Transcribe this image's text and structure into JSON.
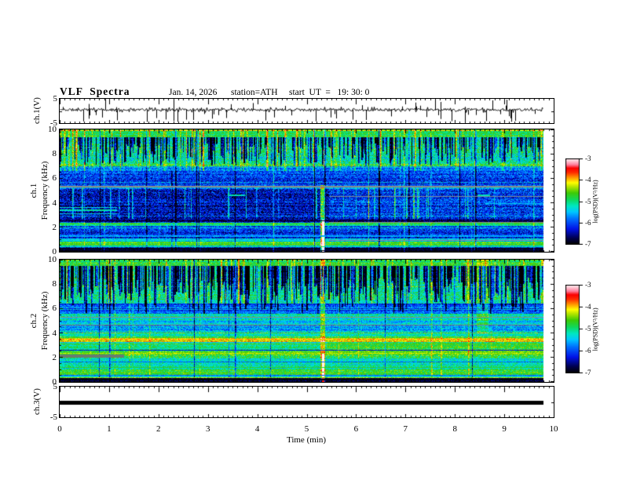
{
  "header": {
    "title": "VLF  Spectra",
    "date": "Jan. 14, 2026",
    "station": "station=ATH",
    "start_ut": "start  UT  =   19: 30: 0"
  },
  "x_axis": {
    "label": "Time  (min)",
    "major_ticks": [
      "0",
      "1",
      "2",
      "3",
      "4",
      "5",
      "6",
      "7",
      "8",
      "9",
      "10"
    ],
    "minor_step_min": 0.1,
    "range_min": [
      0,
      10
    ]
  },
  "panels": {
    "ch1_wave": {
      "ylabel": "ch.1(V)",
      "yticks": [
        "5",
        "-5"
      ],
      "ylim": [
        -5,
        5
      ]
    },
    "ch1_spec": {
      "ylabel_channel": "ch.1",
      "ylabel_axis": "Frequency  (kHz)",
      "yticks": [
        "10",
        "8",
        "6",
        "4",
        "2",
        "0"
      ],
      "ylim": [
        0,
        10
      ]
    },
    "ch2_spec": {
      "ylabel_channel": "ch.2",
      "ylabel_axis": "Frequency  (kHz)",
      "yticks": [
        "10",
        "8",
        "6",
        "4",
        "2",
        "0"
      ],
      "ylim": [
        0,
        10
      ]
    },
    "ch3_wave": {
      "ylabel": "ch.3(V)",
      "yticks": [
        "5",
        "-5"
      ],
      "ylim": [
        -5,
        5
      ]
    }
  },
  "colorbar": {
    "label": "log(PSD)(V²/Hz)",
    "ticks": [
      "-3",
      "-4",
      "-5",
      "-6",
      "-7"
    ],
    "range": [
      -7,
      -3
    ],
    "gradient_stops": [
      [
        0.0,
        "#000000"
      ],
      [
        0.07,
        "#00004a"
      ],
      [
        0.18,
        "#0013e8"
      ],
      [
        0.3,
        "#0073ff"
      ],
      [
        0.38,
        "#00c8ff"
      ],
      [
        0.45,
        "#00e8c0"
      ],
      [
        0.52,
        "#0fd95f"
      ],
      [
        0.6,
        "#3ecb06"
      ],
      [
        0.68,
        "#c0e800"
      ],
      [
        0.72,
        "#ffff00"
      ],
      [
        0.78,
        "#ff9700"
      ],
      [
        0.84,
        "#ff2a00"
      ],
      [
        0.89,
        "#fb0000"
      ],
      [
        0.93,
        "#ff7c9a"
      ],
      [
        0.97,
        "#ffc3d0"
      ],
      [
        1.0,
        "#fff2f5"
      ]
    ]
  },
  "chart_data": [
    {
      "type": "line",
      "panel": "ch1_wave",
      "title": "ch.1 voltage waveform",
      "ylim": [
        -5,
        5
      ],
      "x_data_end_min": 9.8,
      "signal": {
        "baseline_v": 0.5,
        "noise_amp_v": 0.55,
        "spike_count": 62,
        "spike_amp_v": [
          1.2,
          4.6
        ],
        "spike_downward_fraction": 0.7
      },
      "seed": 11
    },
    {
      "type": "heatmap",
      "panel": "ch1_spec",
      "xlim": [
        0,
        10
      ],
      "ylim": [
        0,
        10
      ],
      "x_data_end_min": 9.8,
      "value_range": [
        -7,
        -3
      ],
      "bands": [
        {
          "f0": 0.0,
          "f1": 0.3,
          "level": -6.9,
          "var": 0.15
        },
        {
          "f0": 0.3,
          "f1": 0.5,
          "level": -6.2,
          "var": 0.45
        },
        {
          "f0": 0.5,
          "f1": 0.82,
          "level": -4.65,
          "var": 0.3
        },
        {
          "f0": 0.82,
          "f1": 1.05,
          "level": -5.4,
          "var": 0.35
        },
        {
          "f0": 1.05,
          "f1": 2.1,
          "level": -6.15,
          "var": 0.5
        },
        {
          "f0": 2.1,
          "f1": 2.35,
          "level": -4.95,
          "var": 0.35
        },
        {
          "f0": 2.35,
          "f1": 2.65,
          "level": -6.6,
          "var": 0.45
        },
        {
          "f0": 2.65,
          "f1": 5.2,
          "level": -6.4,
          "var": 0.55
        },
        {
          "f0": 5.2,
          "f1": 5.45,
          "level": -5.7,
          "var": 0.5
        },
        {
          "f0": 5.45,
          "f1": 6.6,
          "level": -6.1,
          "var": 0.5
        },
        {
          "f0": 6.6,
          "f1": 7.0,
          "level": -5.7,
          "var": 0.5
        },
        {
          "f0": 7.0,
          "f1": 9.4,
          "level": -5.15,
          "var": 0.5
        },
        {
          "f0": 9.4,
          "f1": 10.0,
          "level": -4.8,
          "var": 0.35
        }
      ],
      "lines": [
        {
          "f": 0.08,
          "w": 0.07,
          "level": -7
        },
        {
          "f": 0.22,
          "w": 0.05,
          "level": -7
        },
        {
          "f": 0.4,
          "w": 0.05,
          "level": -5.1
        },
        {
          "f": 1.27,
          "w": 0.1,
          "level": -5.6
        },
        {
          "f": 2.5,
          "w": 0.06,
          "level": -6.9
        },
        {
          "f": 3.08,
          "w": 0.06,
          "level": -5.4,
          "t1": 1.15
        },
        {
          "f": 3.38,
          "w": 0.08,
          "level": -5.2,
          "t1": 1.15
        },
        {
          "f": 3.62,
          "w": 0.07,
          "level": -5.3,
          "t1": 1.15
        },
        {
          "f": 4.6,
          "w": 0.16,
          "level": -5.2,
          "t0": 3.4,
          "t1": 3.75
        },
        {
          "f": 4.62,
          "w": 0.14,
          "level": -5.15,
          "t0": 8.45,
          "t1": 8.7
        },
        {
          "f": 3.95,
          "w": 0.07,
          "level": -5.5,
          "t0": 8.6
        },
        {
          "f": 5.32,
          "w": 0.09,
          "color": "#8a8a8a"
        },
        {
          "f": 4.52,
          "w": 0.12,
          "color": "#7d8e96",
          "t0": 5.45
        },
        {
          "f": 2.38,
          "w": 0.06,
          "color": "#8a8a80",
          "t0": 5.45
        },
        {
          "f": 0.88,
          "w": 0.05,
          "color": "#8a8a8a",
          "t0": 5.45
        }
      ],
      "patches": [
        {
          "f0": 2.65,
          "f1": 5.2,
          "t0": 5.45,
          "dlevel": 0.3
        }
      ],
      "vfeatures": [
        {
          "density": 0.42,
          "f_top": 9.4,
          "f_bottom": [
            7.0,
            8.9
          ],
          "dlevel": -1.7
        },
        {
          "density": 0.07,
          "f_top": 10.0,
          "f_bottom": [
            6.6,
            6.6
          ],
          "dlevel": 0.7
        },
        {
          "density": 0.06,
          "f_top": 5.2,
          "f_bottom": [
            2.65,
            2.65
          ],
          "dlevel": 0.9
        },
        {
          "density": 0.02,
          "f_top": 10.0,
          "f_bottom": [
            0,
            0
          ],
          "dlevel": -1.1
        },
        {
          "density": 0.03,
          "f_top": 10.0,
          "f_bottom": [
            0,
            0
          ],
          "dlevel": 0.45
        }
      ],
      "events": [
        {
          "t": 5.32,
          "w": 0.08,
          "f0": 0,
          "f1": 5.45,
          "dlevel": 1.6
        },
        {
          "t": 5.32,
          "w": 0.035,
          "f0": 0,
          "f1": 2.6,
          "dlevel": 2.6
        }
      ],
      "row_noise": {
        "bright_prob": 0.09,
        "bright_boost": 0.55,
        "base": 0.22
      },
      "seed": 23
    },
    {
      "type": "heatmap",
      "panel": "ch2_spec",
      "xlim": [
        0,
        10
      ],
      "ylim": [
        0,
        10
      ],
      "x_data_end_min": 9.8,
      "value_range": [
        -7,
        -3
      ],
      "bands": [
        {
          "f0": 0.0,
          "f1": 0.3,
          "level": -6.8,
          "var": 0.25
        },
        {
          "f0": 0.3,
          "f1": 0.62,
          "level": -5.3,
          "var": 0.4
        },
        {
          "f0": 0.62,
          "f1": 0.95,
          "level": -4.85,
          "var": 0.35
        },
        {
          "f0": 0.95,
          "f1": 1.9,
          "level": -5.15,
          "var": 0.4
        },
        {
          "f0": 1.9,
          "f1": 2.22,
          "level": -4.95,
          "var": 0.5
        },
        {
          "f0": 2.22,
          "f1": 2.5,
          "level": -4.55,
          "var": 0.3
        },
        {
          "f0": 2.5,
          "f1": 3.28,
          "level": -5.1,
          "var": 0.35
        },
        {
          "f0": 3.28,
          "f1": 3.58,
          "level": -4.35,
          "var": 0.4
        },
        {
          "f0": 3.58,
          "f1": 4.05,
          "level": -5.25,
          "var": 0.35
        },
        {
          "f0": 4.05,
          "f1": 4.62,
          "level": -5.65,
          "var": 0.45
        },
        {
          "f0": 4.62,
          "f1": 5.2,
          "level": -5.45,
          "var": 0.4
        },
        {
          "f0": 5.2,
          "f1": 5.55,
          "level": -5.15,
          "var": 0.4
        },
        {
          "f0": 5.55,
          "f1": 6.45,
          "level": -6.1,
          "var": 0.45
        },
        {
          "f0": 6.45,
          "f1": 9.5,
          "level": -5.05,
          "var": 0.45
        },
        {
          "f0": 9.5,
          "f1": 10.0,
          "level": -4.85,
          "var": 0.35
        }
      ],
      "lines": [
        {
          "f": 3.46,
          "w": 0.1,
          "level": -3.95
        },
        {
          "f": 3.1,
          "w": 0.06,
          "level": -4.6
        },
        {
          "f": 2.6,
          "w": 0.08,
          "level": -6.3
        },
        {
          "f": 2.35,
          "w": 0.06,
          "level": -4.3
        },
        {
          "f": 1.62,
          "w": 0.06,
          "level": -5.9
        },
        {
          "f": 1.18,
          "w": 0.07,
          "level": -4.75
        },
        {
          "f": 0.78,
          "w": 0.05,
          "level": -4.5
        },
        {
          "f": 0.5,
          "w": 0.05,
          "level": -5.9
        },
        {
          "f": 0.35,
          "w": 0.06,
          "level": -4.35
        },
        {
          "f": 0.1,
          "w": 0.06,
          "level": -7
        },
        {
          "f": 0.2,
          "w": 0.05,
          "level": -7
        },
        {
          "f": 5.3,
          "w": 0.08,
          "color": "#8a8a8a"
        },
        {
          "f": 4.62,
          "w": 0.07,
          "color": "#7d7d7d"
        },
        {
          "f": 2.1,
          "w": 0.25,
          "color": "#6a7a72",
          "t1": 1.3
        },
        {
          "f": 4.35,
          "w": 0.05,
          "level": -6.2
        }
      ],
      "patches": [
        {
          "f0": 2.5,
          "f1": 3.28,
          "t0": 5.4,
          "dlevel": 0.3
        },
        {
          "f0": 1.9,
          "f1": 2.5,
          "t0": 1.3,
          "dlevel": 0.15
        }
      ],
      "vfeatures": [
        {
          "density": 0.5,
          "f_top": 9.5,
          "f_bottom": [
            6.45,
            8.6
          ],
          "dlevel": -1.9
        },
        {
          "density": 0.12,
          "f_top": 9.5,
          "f_bottom": [
            5.55,
            6.45
          ],
          "dlevel": -1.4
        },
        {
          "density": 0.07,
          "f_top": 10.0,
          "f_bottom": [
            6.45,
            6.45
          ],
          "dlevel": 0.6
        },
        {
          "density": 0.02,
          "f_top": 10.0,
          "f_bottom": [
            0,
            0
          ],
          "dlevel": -1.0
        },
        {
          "density": 0.03,
          "f_top": 10.0,
          "f_bottom": [
            0.3,
            0.3
          ],
          "dlevel": 0.5
        }
      ],
      "events": [
        {
          "t": 5.32,
          "w": 0.08,
          "f0": 0,
          "f1": 10,
          "dlevel": 0.9
        },
        {
          "t": 5.32,
          "w": 0.035,
          "f0": 0,
          "f1": 2.3,
          "dlevel": 2.4
        },
        {
          "t": 8.55,
          "w": 0.22,
          "f0": 4,
          "f1": 10,
          "dlevel": 0.5
        }
      ],
      "row_noise": {
        "bright_prob": 0.1,
        "bright_boost": 0.5,
        "base": 0.22
      },
      "seed": 57
    },
    {
      "type": "line",
      "panel": "ch3_wave",
      "title": "ch.3 voltage waveform (flat)",
      "ylim": [
        -5,
        5
      ],
      "x_data_end_min": 9.8,
      "flat_value_v": 0,
      "line_thickness_px": 5
    }
  ]
}
